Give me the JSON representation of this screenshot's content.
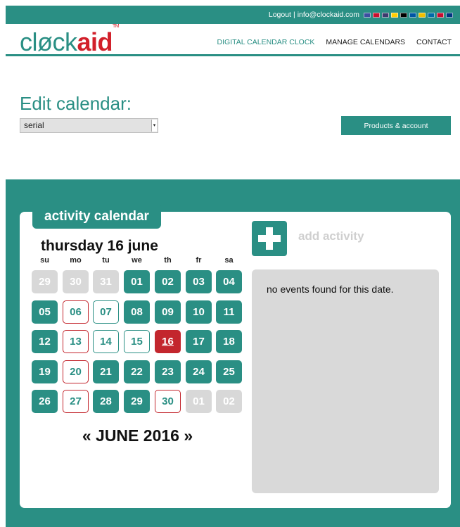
{
  "topbar": {
    "logout": "Logout",
    "separator": "|",
    "email": "info@clockaid.com",
    "flags": [
      {
        "name": "uk-flag-icon",
        "color": "#3b4fa0"
      },
      {
        "name": "nl-flag-icon",
        "color": "#c8102e"
      },
      {
        "name": "us-flag-icon",
        "color": "#3c3b6e"
      },
      {
        "name": "de-flag-icon",
        "color": "#ffce00"
      },
      {
        "name": "be-flag-icon",
        "color": "#000000"
      },
      {
        "name": "fr-flag-icon",
        "color": "#0055a4"
      },
      {
        "name": "es-flag-icon",
        "color": "#f1bf00"
      },
      {
        "name": "se-flag-icon",
        "color": "#006aa7"
      },
      {
        "name": "dk-flag-icon",
        "color": "#c60c30"
      },
      {
        "name": "fi-flag-icon",
        "color": "#003580"
      }
    ]
  },
  "header": {
    "logo_part1": "cløck",
    "logo_part2": "aid",
    "logo_tm": "TM",
    "nav": [
      "DIGITAL CALENDAR CLOCK",
      "MANAGE CALENDARS",
      "CONTACT"
    ]
  },
  "edit": {
    "title": "Edit calendar:",
    "selected_calendar": "serial",
    "dropdown_arrow": "▾",
    "products_button": "Products & account"
  },
  "calendar": {
    "tab_label": "activity calendar",
    "date_heading": "thursday 16 june",
    "days_of_week": [
      "su",
      "mo",
      "tu",
      "we",
      "th",
      "fr",
      "sa"
    ],
    "weeks": [
      [
        {
          "d": "29",
          "s": "gray"
        },
        {
          "d": "30",
          "s": "gray"
        },
        {
          "d": "31",
          "s": "gray"
        },
        {
          "d": "01",
          "s": "teal"
        },
        {
          "d": "02",
          "s": "teal"
        },
        {
          "d": "03",
          "s": "teal"
        },
        {
          "d": "04",
          "s": "teal"
        }
      ],
      [
        {
          "d": "05",
          "s": "teal"
        },
        {
          "d": "06",
          "s": "red-outline"
        },
        {
          "d": "07",
          "s": "teal-outline"
        },
        {
          "d": "08",
          "s": "teal"
        },
        {
          "d": "09",
          "s": "teal"
        },
        {
          "d": "10",
          "s": "teal"
        },
        {
          "d": "11",
          "s": "teal"
        }
      ],
      [
        {
          "d": "12",
          "s": "teal"
        },
        {
          "d": "13",
          "s": "red-outline"
        },
        {
          "d": "14",
          "s": "teal-outline"
        },
        {
          "d": "15",
          "s": "teal-outline"
        },
        {
          "d": "16",
          "s": "red"
        },
        {
          "d": "17",
          "s": "teal"
        },
        {
          "d": "18",
          "s": "teal"
        }
      ],
      [
        {
          "d": "19",
          "s": "teal"
        },
        {
          "d": "20",
          "s": "red-outline"
        },
        {
          "d": "21",
          "s": "teal"
        },
        {
          "d": "22",
          "s": "teal"
        },
        {
          "d": "23",
          "s": "teal"
        },
        {
          "d": "24",
          "s": "teal"
        },
        {
          "d": "25",
          "s": "teal"
        }
      ],
      [
        {
          "d": "26",
          "s": "teal"
        },
        {
          "d": "27",
          "s": "red-outline"
        },
        {
          "d": "28",
          "s": "teal"
        },
        {
          "d": "29",
          "s": "teal"
        },
        {
          "d": "30",
          "s": "red-outline"
        },
        {
          "d": "01",
          "s": "gray"
        },
        {
          "d": "02",
          "s": "gray"
        }
      ]
    ],
    "prev": "«",
    "month_label": "JUNE 2016",
    "next": "»"
  },
  "activity": {
    "add_label": "add activity",
    "no_events": "no events found for this date."
  },
  "colors": {
    "teal": "#2a8f84",
    "red": "#c3262d",
    "gray": "#d8d8d8"
  }
}
